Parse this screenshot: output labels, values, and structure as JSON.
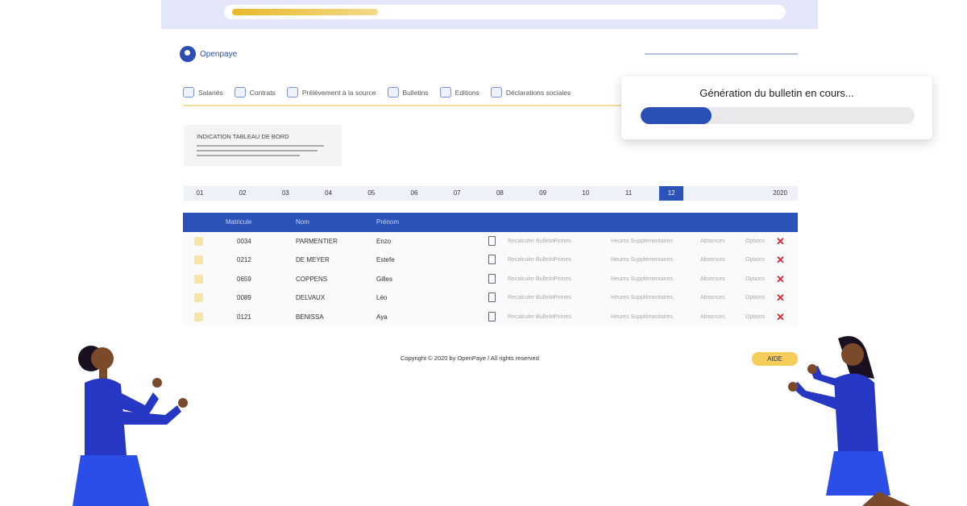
{
  "top_progress": {
    "percent": 26
  },
  "brand": {
    "name": "Openpaye"
  },
  "nav": [
    {
      "label": "Salariés",
      "icon": "users-icon"
    },
    {
      "label": "Contrats",
      "icon": "contracts-icon"
    },
    {
      "label": "Prélèvement à la source",
      "icon": "cloud-icon"
    },
    {
      "label": "Bulletins",
      "icon": "document-icon"
    },
    {
      "label": "Editions",
      "icon": "monitor-icon"
    },
    {
      "label": "Déclarations sociales",
      "icon": "clock-icon"
    }
  ],
  "popup": {
    "title": "Génération du bulletin en cours...",
    "percent": 26
  },
  "dashboard": {
    "title": "INDICATION TABLEAU DE BORD"
  },
  "months": [
    "01",
    "02",
    "03",
    "04",
    "05",
    "06",
    "07",
    "08",
    "09",
    "10",
    "11",
    "12"
  ],
  "active_month": "12",
  "year": "2020",
  "table": {
    "headers": [
      "Matricule",
      "Nom",
      "Prénom"
    ],
    "actions": [
      "Recalculer Bulletin",
      "Primes",
      "Heures Supplémentaires",
      "Absences",
      "Options"
    ],
    "rows": [
      [
        "0034",
        "PARMENTIER",
        "Enzo"
      ],
      [
        "0212",
        "DE MEYER",
        "Estefe"
      ],
      [
        "0659",
        "COPPENS",
        "Gilles"
      ],
      [
        "0089",
        "DELVAUX",
        "Léo"
      ],
      [
        "0121",
        "BENISSA",
        "Aya"
      ]
    ]
  },
  "footer": {
    "copyright": "Copyright © 2020 by OpenPaye / All rights reserved",
    "help": "AIDE"
  },
  "colors": {
    "primary": "#2b52b8",
    "accent": "#f5cd5a"
  }
}
